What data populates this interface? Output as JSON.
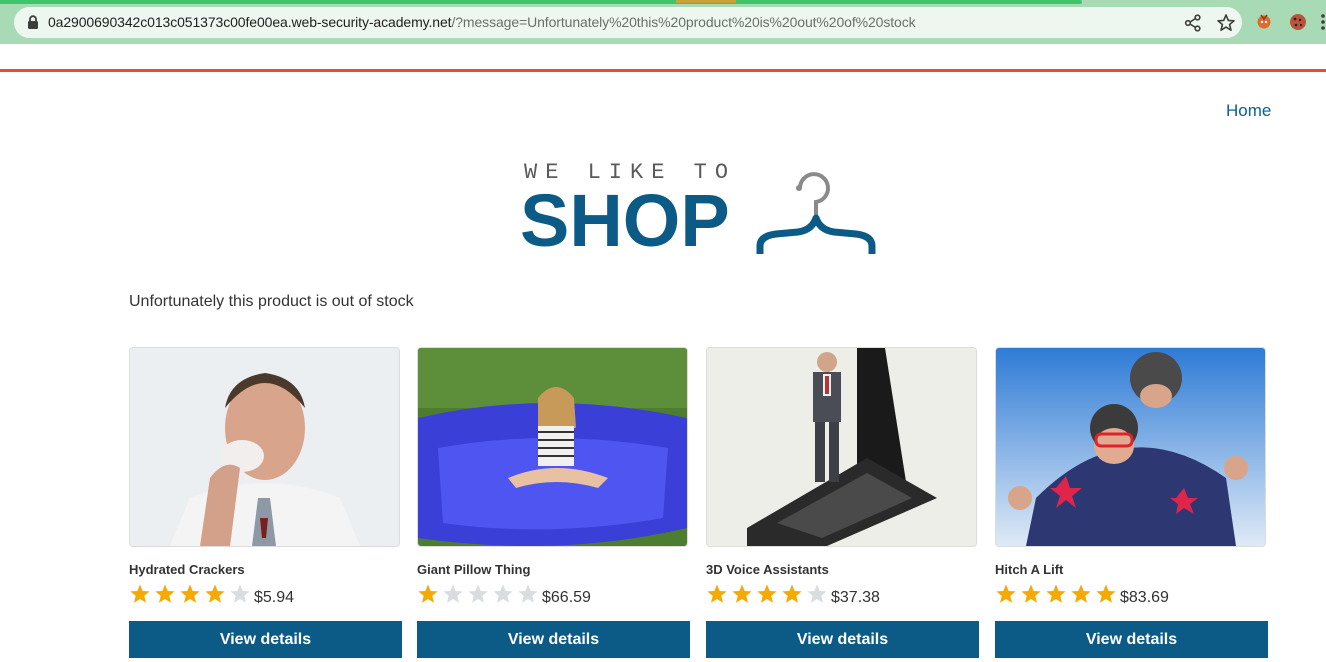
{
  "browser": {
    "url_host": "0a2900690342c013c051373c00fe00ea.web-security-academy.net",
    "url_rest": "/?message=Unfortunately%20this%20product%20is%20out%20of%20stock",
    "icons": [
      "lock-icon",
      "share-icon",
      "star-icon",
      "extension-icon",
      "cookie-extension-icon"
    ]
  },
  "nav": {
    "home_label": "Home"
  },
  "logo": {
    "tagline": "WE LIKE TO",
    "wordmark": "SHOP"
  },
  "message": "Unfortunately this product is out of stock",
  "colors": {
    "accent": "#0b5b86",
    "link": "#0a5e99",
    "header_rule": "#ea4a3c",
    "star_filled": "#f6a900",
    "star_empty": "#d9dde0",
    "chrome_bg": "#a8dab5"
  },
  "products": [
    {
      "name": "Hydrated Crackers",
      "rating": 4,
      "rating_max": 5,
      "price": "$5.94",
      "button_label": "View details"
    },
    {
      "name": "Giant Pillow Thing",
      "rating": 1,
      "rating_max": 5,
      "price": "$66.59",
      "button_label": "View details"
    },
    {
      "name": "3D Voice Assistants",
      "rating": 4,
      "rating_max": 5,
      "price": "$37.38",
      "button_label": "View details"
    },
    {
      "name": "Hitch A Lift",
      "rating": 5,
      "rating_max": 5,
      "price": "$83.69",
      "button_label": "View details"
    }
  ]
}
